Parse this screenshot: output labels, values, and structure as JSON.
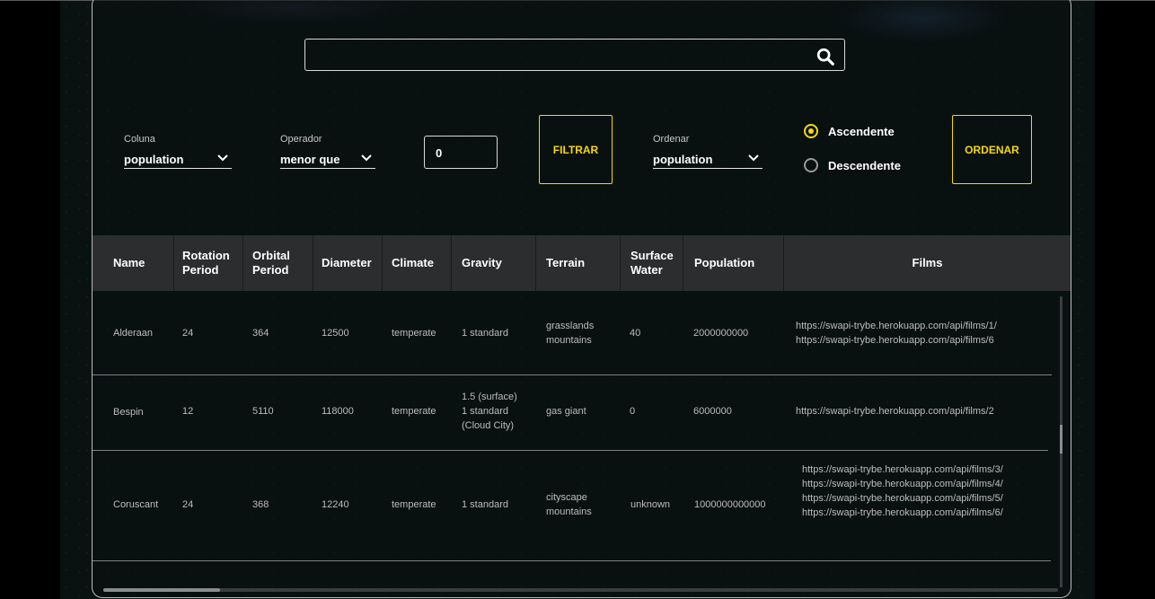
{
  "search": {
    "value": "",
    "placeholder": ""
  },
  "filters": {
    "column_label": "Coluna",
    "column_value": "population",
    "operator_label": "Operador",
    "operator_value": "menor que",
    "number_value": "0",
    "filter_button": "FILTRAR",
    "sort_label": "Ordenar",
    "sort_value": "population",
    "asc_label": "Ascendente",
    "desc_label": "Descendente",
    "sort_button": "ORDENAR",
    "selected_order": "Ascendente"
  },
  "colors": {
    "accent": "#f5d90a",
    "header_bg": "#2c2d2f"
  },
  "table": {
    "headers": [
      "Name",
      "Rotation Period",
      "Orbital Period",
      "Diameter",
      "Climate",
      "Gravity",
      "Terrain",
      "Surface Water",
      "Population",
      "Films"
    ],
    "rows": [
      {
        "name": "Alderaan",
        "rotation": "24",
        "orbital": "364",
        "diameter": "12500",
        "climate": "temperate",
        "gravity": [
          "1 standard"
        ],
        "terrain": [
          "grasslands",
          "mountains"
        ],
        "water": "40",
        "population": "2000000000",
        "films": [
          "https://swapi-trybe.herokuapp.com/api/films/1/",
          "https://swapi-trybe.herokuapp.com/api/films/6"
        ]
      },
      {
        "name": "Bespin",
        "rotation": "12",
        "orbital": "5110",
        "diameter": "118000",
        "climate": "temperate",
        "gravity": [
          "1.5 (surface)",
          "1 standard",
          "(Cloud City)"
        ],
        "terrain": [
          "gas giant"
        ],
        "water": "0",
        "population": "6000000",
        "films": [
          "https://swapi-trybe.herokuapp.com/api/films/2"
        ]
      },
      {
        "name": "Coruscant",
        "rotation": "24",
        "orbital": "368",
        "diameter": "12240",
        "climate": "temperate",
        "gravity": [
          "1 standard"
        ],
        "terrain": [
          "cityscape",
          "mountains"
        ],
        "water": "unknown",
        "population": "1000000000000",
        "films": [
          "https://swapi-trybe.herokuapp.com/api/films/3/",
          "https://swapi-trybe.herokuapp.com/api/films/4/",
          "https://swapi-trybe.herokuapp.com/api/films/5/",
          "https://swapi-trybe.herokuapp.com/api/films/6/"
        ]
      }
    ]
  }
}
